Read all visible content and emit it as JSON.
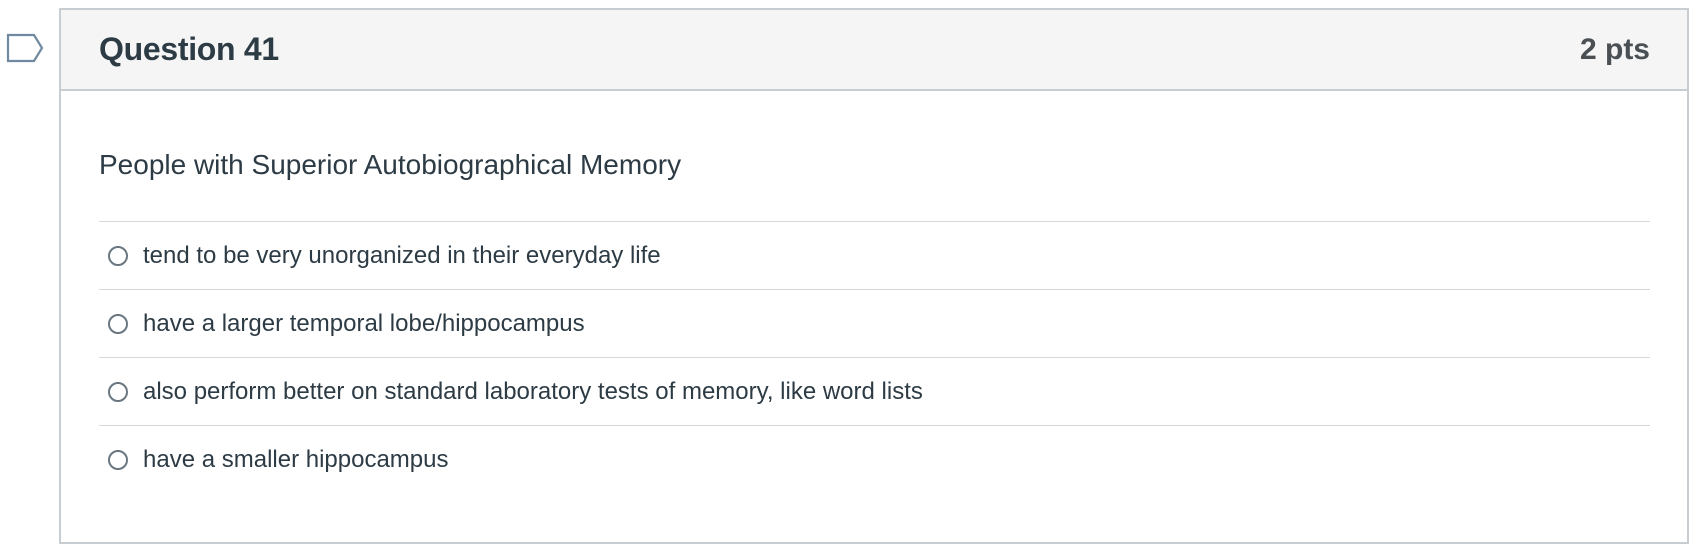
{
  "question": {
    "title": "Question 41",
    "points": "2 pts",
    "prompt": "People with Superior Autobiographical Memory",
    "flag_icon": "bookmark-flag-icon",
    "answers": [
      {
        "label": "tend to be very unorganized in their everyday life",
        "selected": false
      },
      {
        "label": "have a larger temporal lobe/hippocampus",
        "selected": false
      },
      {
        "label": "also perform better on standard laboratory tests of memory, like word lists",
        "selected": false
      },
      {
        "label": "have a smaller hippocampus",
        "selected": false
      }
    ]
  },
  "colors": {
    "header_bg": "#f5f5f5",
    "border": "#c7cdd1",
    "text": "#2d3b45",
    "flag_stroke": "#6f8aa0"
  }
}
